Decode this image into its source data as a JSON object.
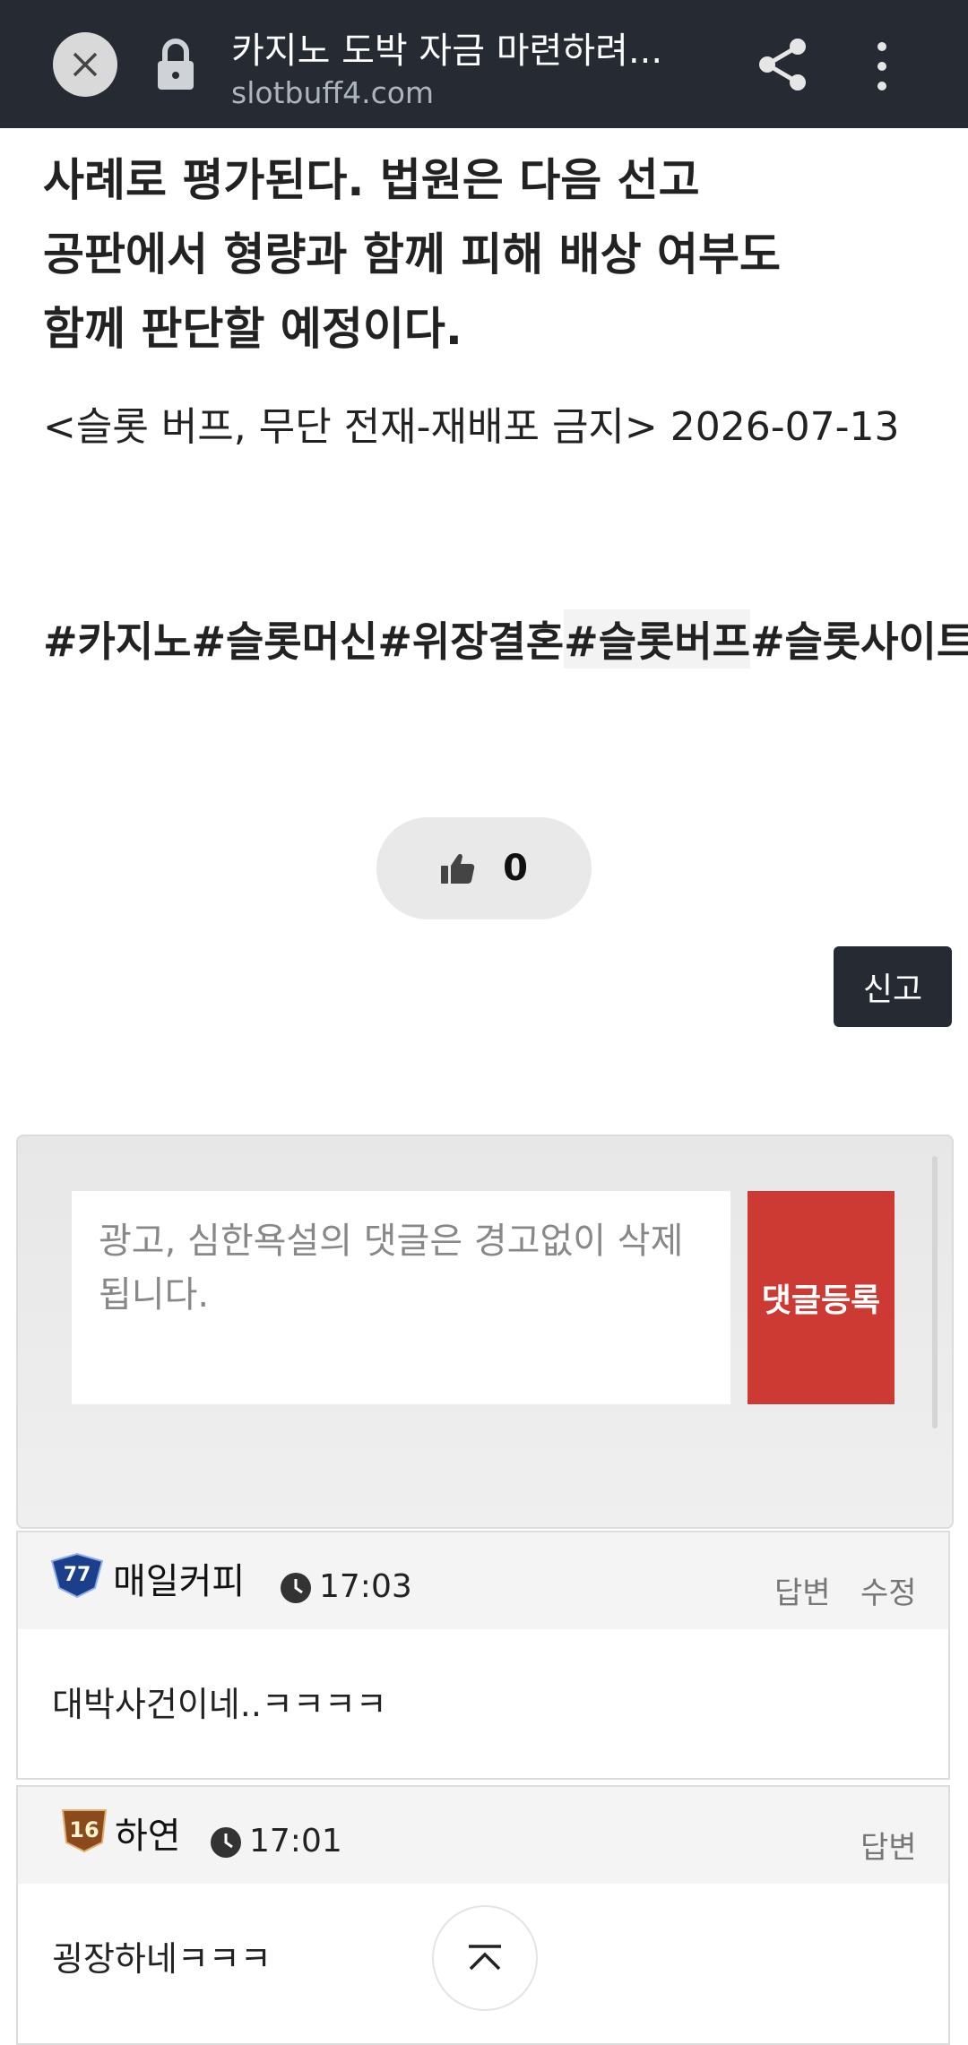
{
  "browser": {
    "title": "카지노 도박 자금 마련하려...",
    "url": "slotbuff4.com"
  },
  "article": {
    "paragraph_lines": [
      "사례로 평가된다. 법원은 다음 선고",
      "공판에서 형량과 함께 피해 배상 여부도",
      "함께 판단할 예정이다."
    ],
    "byline": "<슬롯 버프, 무단 전재-재배포 금지> 2026-07-13",
    "tags": [
      "#카지노",
      "#슬롯머신",
      "#위장결혼",
      "#슬롯버프",
      "#슬롯사이트"
    ]
  },
  "like": {
    "count": "0"
  },
  "report_label": "신고",
  "comment_form": {
    "placeholder": "광고, 심한욕설의 댓글은 경고없이 삭제됩니다.",
    "submit_label": "댓글등록"
  },
  "comments": [
    {
      "author": "매일커피",
      "badge": "77",
      "time": "17:03",
      "actions": [
        "답변",
        "수정"
      ],
      "text": "대박사건이네..ㅋㅋㅋㅋ"
    },
    {
      "author": "하연",
      "badge": "16",
      "time": "17:01",
      "actions": [
        "답변"
      ],
      "text": "굉장하네ㅋㅋㅋ"
    }
  ],
  "colors": {
    "topbar": "#262b33",
    "submit": "#cc3a33"
  }
}
